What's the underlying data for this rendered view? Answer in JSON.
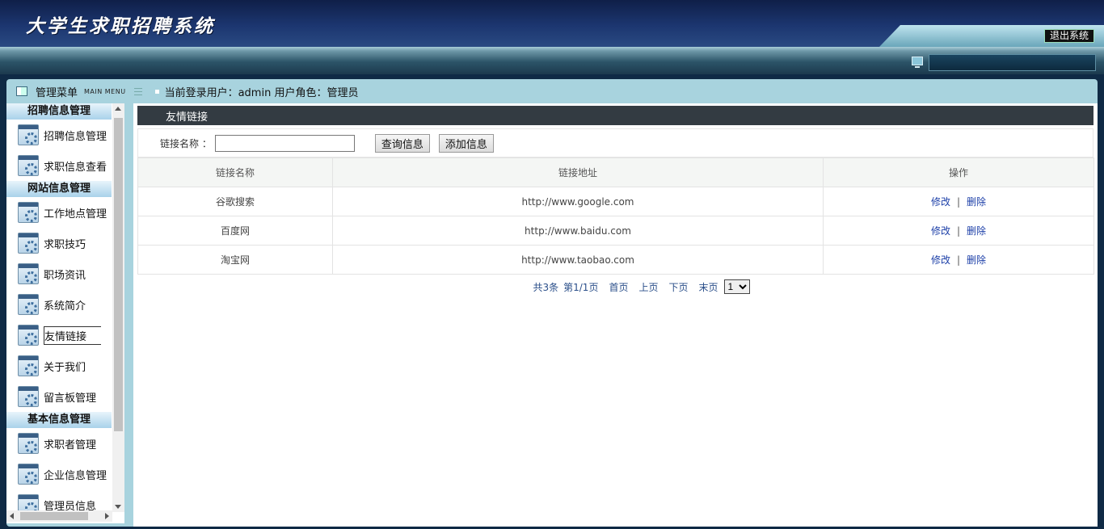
{
  "header": {
    "app_title": "大学生求职招聘系统",
    "logout_label": "退出系统"
  },
  "titlebar": {
    "menu_title": "管理菜单",
    "menu_sub": "MAIN MENU",
    "user_info": "当前登录用户：admin  用户角色：管理员"
  },
  "sidebar": {
    "groups": [
      {
        "title": "招聘信息管理",
        "items": [
          "招聘信息管理",
          "求职信息查看"
        ]
      },
      {
        "title": "网站信息管理",
        "items": [
          "工作地点管理",
          "求职技巧",
          "职场资讯",
          "系统简介",
          "友情链接",
          "关于我们",
          "留言板管理"
        ]
      },
      {
        "title": "基本信息管理",
        "items": [
          "求职者管理",
          "企业信息管理",
          "管理员信息"
        ]
      }
    ],
    "active_item": "友情链接"
  },
  "panel": {
    "title": "友情链接",
    "search_label": "链接名称 ：",
    "search_value": "",
    "query_button": "查询信息",
    "add_button": "添加信息"
  },
  "table": {
    "columns": [
      "链接名称",
      "链接地址",
      "操作"
    ],
    "rows": [
      {
        "name": "谷歌搜索",
        "url": "http://www.google.com"
      },
      {
        "name": "百度网",
        "url": "http://www.baidu.com"
      },
      {
        "name": "淘宝网",
        "url": "http://www.taobao.com"
      }
    ],
    "edit_label": "修改",
    "delete_label": "删除",
    "separator": "|"
  },
  "pager": {
    "total": "共3条",
    "page": "第1/1页",
    "first": "首页",
    "prev": "上页",
    "next": "下页",
    "last": "末页",
    "selected_page": "1"
  }
}
